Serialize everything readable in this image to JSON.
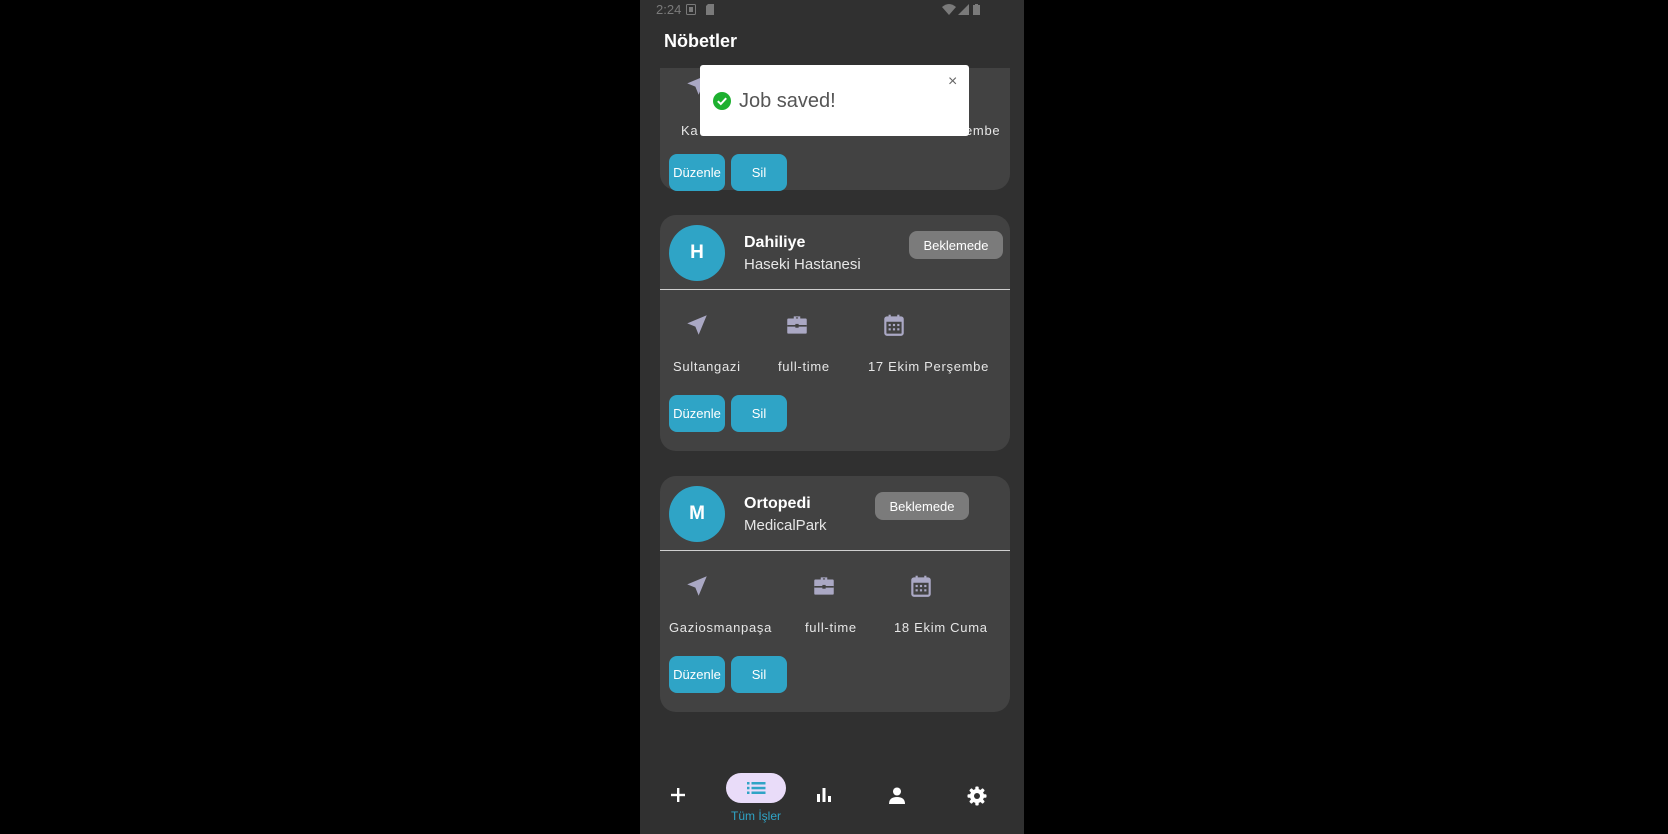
{
  "status_bar": {
    "time": "2:24"
  },
  "app_bar": {
    "title": "Nöbetler"
  },
  "toast": {
    "message": "Job saved!",
    "close_symbol": "×"
  },
  "cards": [
    {
      "avatar_letter": "",
      "title": "",
      "subtitle": "",
      "badge": "",
      "location": "Ka",
      "job_type": "",
      "date": "embe",
      "edit_label": "Düzenle",
      "delete_label": "Sil"
    },
    {
      "avatar_letter": "H",
      "title": "Dahiliye",
      "subtitle": "Haseki Hastanesi",
      "badge": "Beklemede",
      "location": "Sultangazi",
      "job_type": "full-time",
      "date": "17 Ekim Perşembe",
      "edit_label": "Düzenle",
      "delete_label": "Sil"
    },
    {
      "avatar_letter": "M",
      "title": "Ortopedi",
      "subtitle": "MedicalPark",
      "badge": "Beklemede",
      "location": "Gaziosmanpaşa",
      "job_type": "full-time",
      "date": "18 Ekim Cuma",
      "edit_label": "Düzenle",
      "delete_label": "Sil"
    }
  ],
  "bottom_nav": {
    "items": [
      {
        "icon": "plus-icon",
        "label": ""
      },
      {
        "icon": "list-icon",
        "label": "Tüm İşler",
        "active": true
      },
      {
        "icon": "bar-chart-icon",
        "label": ""
      },
      {
        "icon": "person-icon",
        "label": ""
      },
      {
        "icon": "gear-icon",
        "label": ""
      }
    ]
  },
  "colors": {
    "accent": "#2fa4c6",
    "background": "#303030",
    "card": "#424242",
    "badge": "#7b7b7b",
    "nav_pill": "#e9dcf9",
    "success": "#1db02f"
  }
}
